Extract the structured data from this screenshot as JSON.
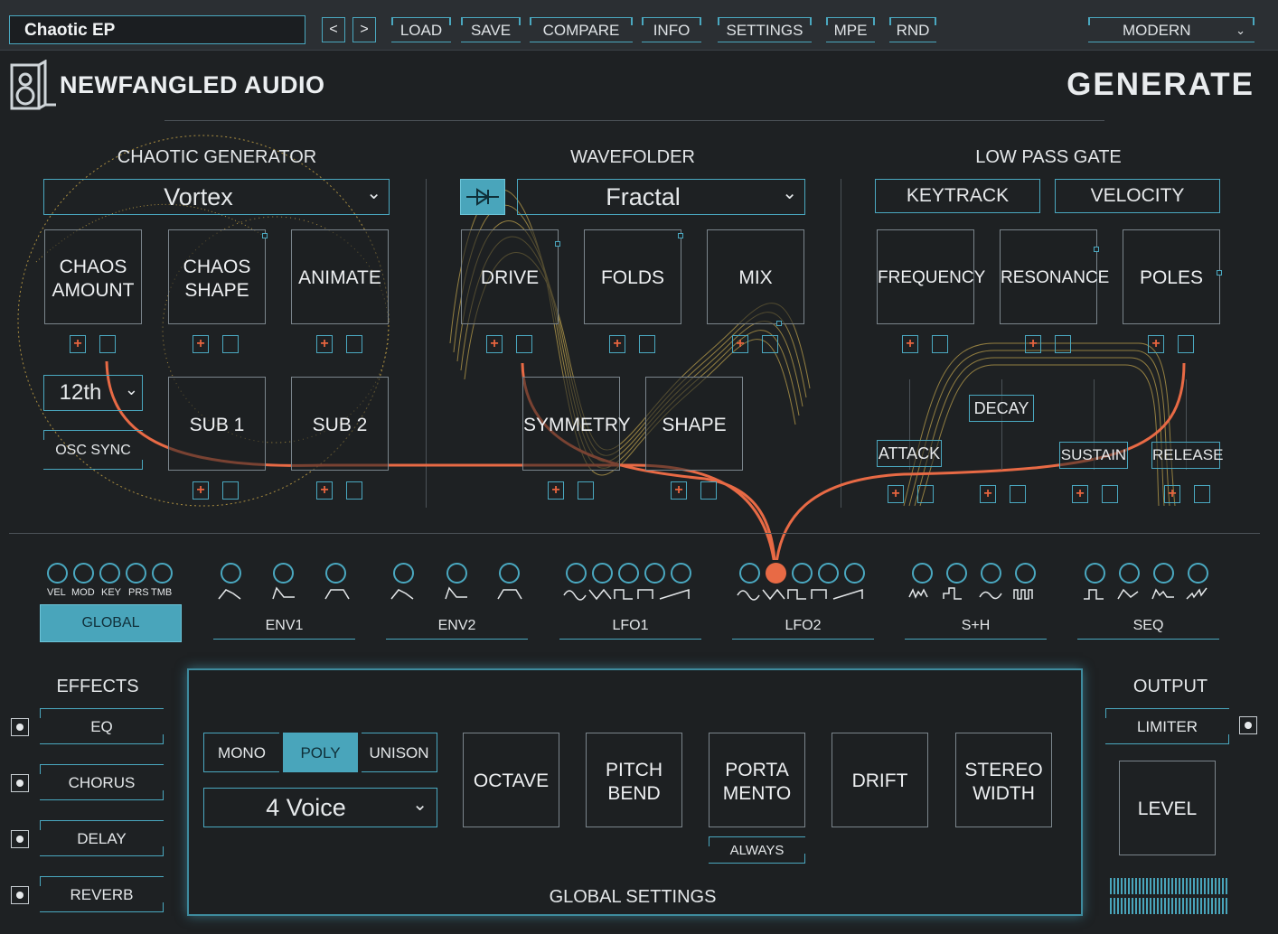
{
  "topbar": {
    "preset": "Chaotic EP",
    "prev": "<",
    "next": ">",
    "load": "LOAD",
    "save": "SAVE",
    "compare": "COMPARE",
    "info": "INFO",
    "settings": "SETTINGS",
    "mpe": "MPE",
    "rnd": "RND",
    "theme": "MODERN"
  },
  "header": {
    "brand": "NEWFANGLED AUDIO",
    "product": "GENERATE"
  },
  "chaotic": {
    "title": "CHAOTIC GENERATOR",
    "mode": "Vortex",
    "knob1": "CHAOS",
    "knob1b": "AMOUNT",
    "knob2": "CHAOS",
    "knob2b": "SHAPE",
    "knob3": "ANIMATE",
    "octave": "12th",
    "osc_sync": "OSC SYNC",
    "sub1": "SUB 1",
    "sub2": "SUB 2"
  },
  "wavefolder": {
    "title": "WAVEFOLDER",
    "mode": "Fractal",
    "drive": "DRIVE",
    "folds": "FOLDS",
    "mix": "MIX",
    "symmetry": "SYMMETRY",
    "shape": "SHAPE"
  },
  "lpg": {
    "title": "LOW PASS GATE",
    "keytrack": "KEYTRACK",
    "velocity": "VELOCITY",
    "frequency": "FREQUENCY",
    "resonance": "RESONANCE",
    "poles": "POLES",
    "attack": "ATTACK",
    "decay": "DECAY",
    "sustain": "SUSTAIN",
    "release": "RELEASE"
  },
  "mod": {
    "global_subs": [
      "VEL",
      "MOD",
      "KEY",
      "PRS",
      "TMB"
    ],
    "sources": [
      "GLOBAL",
      "ENV1",
      "ENV2",
      "LFO1",
      "LFO2",
      "S+H",
      "SEQ"
    ]
  },
  "effects": {
    "title": "EFFECTS",
    "items": [
      "EQ",
      "CHORUS",
      "DELAY",
      "REVERB"
    ]
  },
  "global": {
    "title": "GLOBAL SETTINGS",
    "mono": "MONO",
    "poly": "POLY",
    "unison": "UNISON",
    "voices": "4 Voice",
    "octave": "OCTAVE",
    "pitch1": "PITCH",
    "pitch2": "BEND",
    "porta1": "PORTA",
    "porta2": "MENTO",
    "always": "ALWAYS",
    "drift": "DRIFT",
    "stereo1": "STEREO",
    "stereo2": "WIDTH"
  },
  "output": {
    "title": "OUTPUT",
    "limiter": "LIMITER",
    "level": "LEVEL"
  },
  "colors": {
    "accent": "#4aa8c0",
    "mod": "#e86a45",
    "trace": "#e7c25a"
  }
}
